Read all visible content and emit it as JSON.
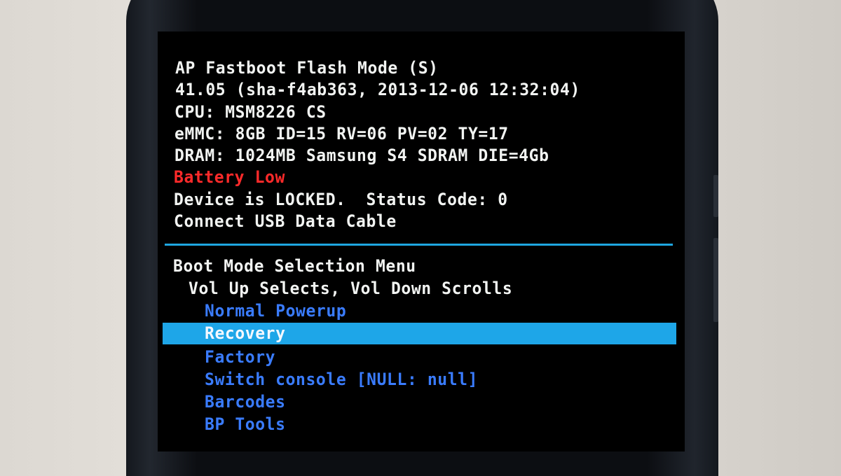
{
  "info": {
    "mode": "AP Fastboot Flash Mode (S)",
    "version": "41.05 (sha-f4ab363, 2013-12-06 12:32:04)",
    "cpu": "CPU: MSM8226 CS",
    "emmc": "eMMC: 8GB ID=15 RV=06 PV=02 TY=17",
    "dram": "DRAM: 1024MB Samsung S4 SDRAM DIE=4Gb",
    "battery": "Battery Low",
    "status": "Device is LOCKED.  Status Code: 0",
    "usb": "Connect USB Data Cable"
  },
  "menu": {
    "title": "Boot Mode Selection Menu",
    "instructions": "Vol Up Selects, Vol Down Scrolls",
    "selected": "Recovery",
    "items": [
      "Normal Powerup",
      "Recovery",
      "Factory",
      "Switch console [NULL: null]",
      "Barcodes",
      "BP Tools"
    ]
  },
  "colors": {
    "text": "#f2f4f2",
    "warning": "#ff2a2a",
    "menu_item": "#3a7cff",
    "highlight": "#1ea6e8",
    "divider": "#1ea6e0"
  }
}
